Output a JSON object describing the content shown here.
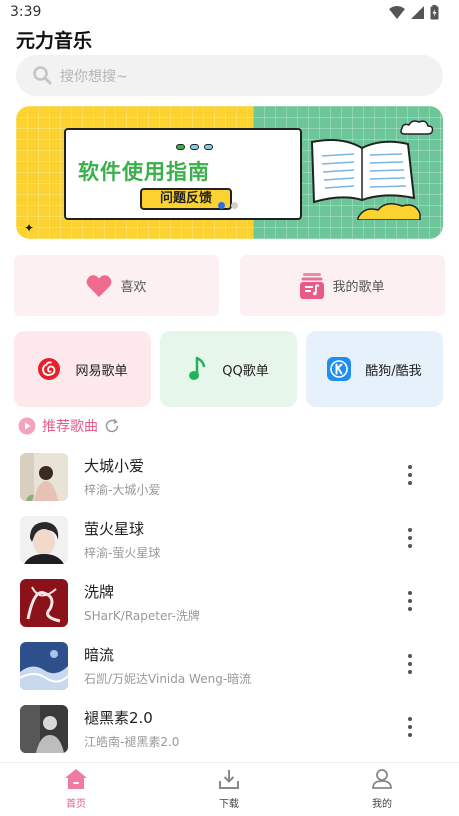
{
  "status_bar": {
    "time": "3:39"
  },
  "app": {
    "title": "元力音乐"
  },
  "search": {
    "placeholder": "搜你想搜~"
  },
  "banner": {
    "title": "软件使用指南",
    "button_label": "问题反馈",
    "page_count": 2,
    "active_index": 0
  },
  "quick_actions": [
    {
      "label": "喜欢",
      "icon": "heart-icon"
    },
    {
      "label": "我的歌单",
      "icon": "playlist-icon"
    }
  ],
  "platforms": [
    {
      "label": "网易歌单",
      "icon": "netease-icon",
      "color": "#e8202a"
    },
    {
      "label": "QQ歌单",
      "icon": "qq-music-icon",
      "color": "#20b35a"
    },
    {
      "label": "酷狗/酷我",
      "icon": "kugou-icon",
      "color": "#1f8ef0"
    }
  ],
  "recommend": {
    "title": "推荐歌曲"
  },
  "songs": [
    {
      "name": "大城小爱",
      "artist": "梓渝-大城小爱"
    },
    {
      "name": "萤火星球",
      "artist": "梓渝-萤火星球"
    },
    {
      "name": "洗牌",
      "artist": "SHarK/Rapeter-洗牌"
    },
    {
      "name": "暗流",
      "artist": "石凯/万妮达Vinida Weng-暗流"
    },
    {
      "name": "褪黑素2.0",
      "artist": "江皓南-褪黑素2.0"
    }
  ],
  "bottom_nav": [
    {
      "label": "首页",
      "icon": "home-icon",
      "active": true
    },
    {
      "label": "下载",
      "icon": "download-icon",
      "active": false
    },
    {
      "label": "我的",
      "icon": "profile-icon",
      "active": false
    }
  ],
  "colors": {
    "accent": "#e35d8c",
    "banner_yellow": "#fbd22f",
    "banner_green": "#6cc69a"
  }
}
